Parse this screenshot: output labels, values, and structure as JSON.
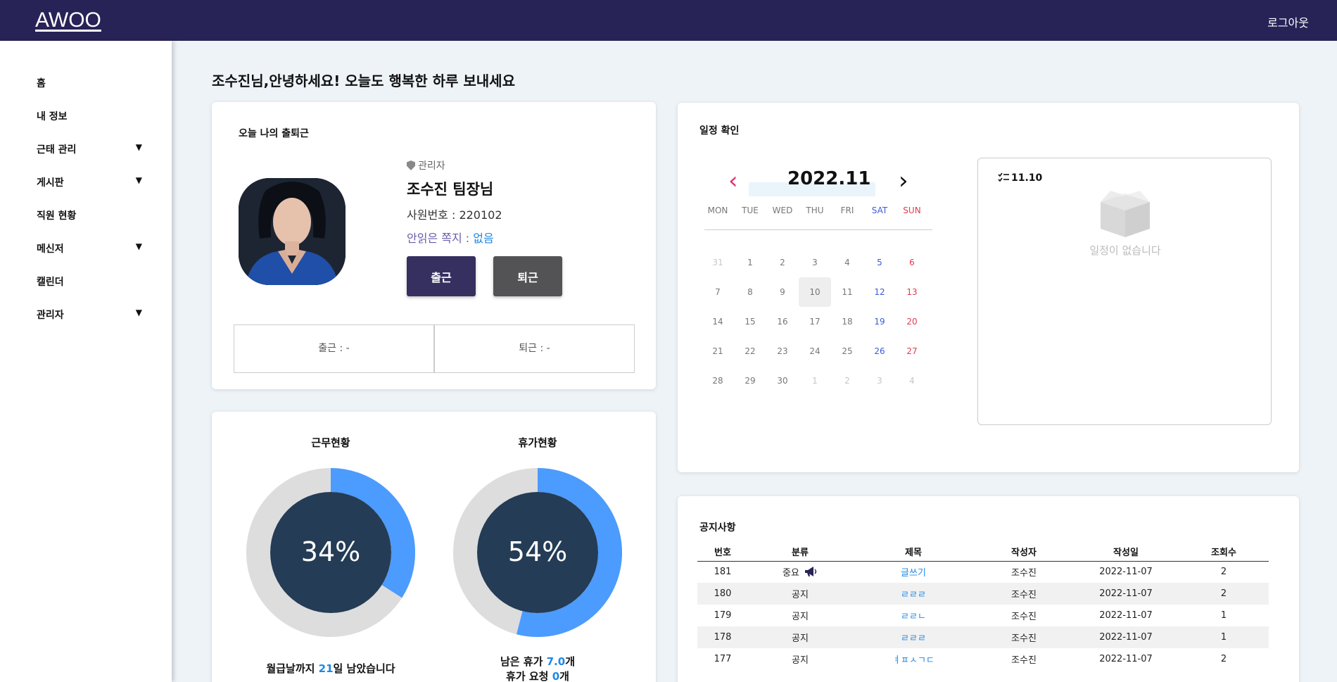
{
  "header": {
    "logo": "AWOO",
    "logout": "로그아웃"
  },
  "sidebar": {
    "items": [
      {
        "label": "홈",
        "has_submenu": false
      },
      {
        "label": "내 정보",
        "has_submenu": false
      },
      {
        "label": "근태 관리",
        "has_submenu": true
      },
      {
        "label": "게시판",
        "has_submenu": true
      },
      {
        "label": "직원 현황",
        "has_submenu": false
      },
      {
        "label": "메신저",
        "has_submenu": true
      },
      {
        "label": "캘린더",
        "has_submenu": false
      },
      {
        "label": "관리자",
        "has_submenu": true
      }
    ],
    "arrow": "▼"
  },
  "greeting": "조수진님,안녕하세요! 오늘도 행복한 하루 보내세요",
  "attendance": {
    "title": "오늘 나의 출퇴근",
    "role": "관리자",
    "name": "조수진 팀장님",
    "emp_no": "사원번호 : 220102",
    "unread_label": "안읽은 쪽지 : ",
    "unread_value": "없음",
    "checkin_button": "출근",
    "checkout_button": "퇴근",
    "checkin_time": "출근 :  -",
    "checkout_time": "퇴근 :  -"
  },
  "status": {
    "work": {
      "title": "근무현황",
      "percent": 34,
      "label": "34%",
      "foot_pre": "월급날까지 ",
      "foot_num": "21",
      "foot_post": "일 남았습니다"
    },
    "leave": {
      "title": "휴가현황",
      "percent": 54,
      "label": "54%",
      "foot1_pre": "남은 휴가 ",
      "foot1_num": "7.0",
      "foot1_post": "개",
      "foot2_pre": "휴가 요청 ",
      "foot2_num": "0",
      "foot2_post": "개"
    },
    "colors": {
      "fill": "#4c9bff",
      "track": "#dddddd",
      "center": "#243c55"
    }
  },
  "schedule": {
    "title": "일정 확인",
    "month": "2022.11",
    "prev": "‹",
    "next": "›",
    "weekdays": [
      "MON",
      "TUE",
      "WED",
      "THU",
      "FRI",
      "SAT",
      "SUN"
    ],
    "weeks": [
      [
        "31",
        "1",
        "2",
        "3",
        "4",
        "5",
        "6"
      ],
      [
        "7",
        "8",
        "9",
        "10",
        "11",
        "12",
        "13"
      ],
      [
        "14",
        "15",
        "16",
        "17",
        "18",
        "19",
        "20"
      ],
      [
        "21",
        "22",
        "23",
        "24",
        "25",
        "26",
        "27"
      ],
      [
        "28",
        "29",
        "30",
        "1",
        "2",
        "3",
        "4"
      ]
    ],
    "today": "10",
    "selected_date": "11.10",
    "empty_message": "일정이 없습니다",
    "colors": {
      "sat": "#3c5bd8",
      "sun": "#e03b4f",
      "faded": "#c7c7c7",
      "nav_prev": "#e0336a"
    }
  },
  "notices": {
    "title": "공지사항",
    "columns": [
      "번호",
      "분류",
      "제목",
      "작성자",
      "작성일",
      "조회수"
    ],
    "rows": [
      [
        "181",
        "중요",
        "글쓰기",
        "조수진",
        "2022-11-07",
        "2"
      ],
      [
        "180",
        "공지",
        "ㄹㄹㄹ",
        "조수진",
        "2022-11-07",
        "2"
      ],
      [
        "179",
        "공지",
        "ㄹㄹㄴ",
        "조수진",
        "2022-11-07",
        "1"
      ],
      [
        "178",
        "공지",
        "ㄹㄹㄹ",
        "조수진",
        "2022-11-07",
        "1"
      ],
      [
        "177",
        "공지",
        "ㅕㅍㅅㄱㄷ",
        "조수진",
        "2022-11-07",
        "2"
      ]
    ]
  }
}
